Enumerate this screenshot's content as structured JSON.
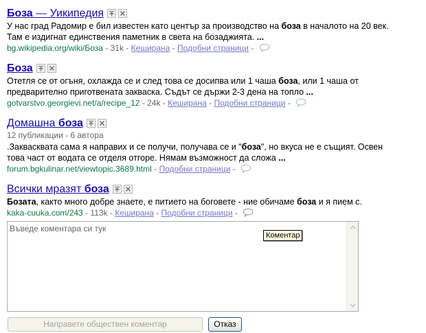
{
  "results": [
    {
      "title_term": "Боза",
      "title_rest": " — Уикипедия",
      "snippet_1": "У нас град Радомир е бил известен като център за производство на ",
      "snippet_bold_1": "боза",
      "snippet_2": " в началото на 20 век. Там е издигнат единствения паметник в света на бозаджията. ",
      "snippet_ellipsis": "...",
      "url": "bg.wikipedia.org/wiki/Боза",
      "size": " - 31k - ",
      "cached": "Кеширана",
      "similar": "Подобни страници"
    },
    {
      "title_term": "Боза",
      "snippet_1": "Отетля се от огъня, охлажда се и след това се досипва или 1 чаша ",
      "snippet_bold_1": "боза",
      "snippet_2": ", или 1 чаша от предварително приготвената закваска. Съдът се държи 2-3 дена на топло ",
      "snippet_ellipsis": "...",
      "url": "gotvarstvo.georgievi.net/a/recipe_12",
      "size": " - 24k - ",
      "cached": "Кеширана",
      "similar": "Подобни страници"
    },
    {
      "title_pre": "Домашна ",
      "title_term": "боза",
      "meta": "12 публикации - 6 автора",
      "snippet_1": ".Заквасквата сама я направих и се получи, получава се и \"",
      "snippet_bold_1": "боза",
      "snippet_2": "\", но вкуса не е същият. Освен това част от водата се отделя отгоре. Нямам възможност да сложа ",
      "snippet_ellipsis": "...",
      "url": "forum.bgkulinar.net/viewtopic.3689.html",
      "size": " - ",
      "similar": "Подобни страници"
    },
    {
      "title_pre": "Всички мразят ",
      "title_term": "боза",
      "snippet_bold_0": "Бозата",
      "snippet_1": ", както много добре знаете, е питието на боговете - ние обичаме ",
      "snippet_bold_1": "боза",
      "snippet_2": " и я пием с.",
      "url": "kaka-cuuka.com/243",
      "size": " - 113k - ",
      "cached": "Кеширана",
      "similar": "Подобни страници"
    }
  ],
  "separator": " - ",
  "tooltip": "Коментар",
  "comment": {
    "placeholder": "Въведе коментара си тук",
    "public_button": "Направете обществен коментар",
    "cancel_button": "Отказ"
  },
  "colors": {
    "title_link": "#1a0dab",
    "url_green": "#0e774a",
    "secondary_link": "#7777cc"
  },
  "icons": [
    "promote-icon",
    "remove-icon",
    "comment-bubble-icon"
  ]
}
